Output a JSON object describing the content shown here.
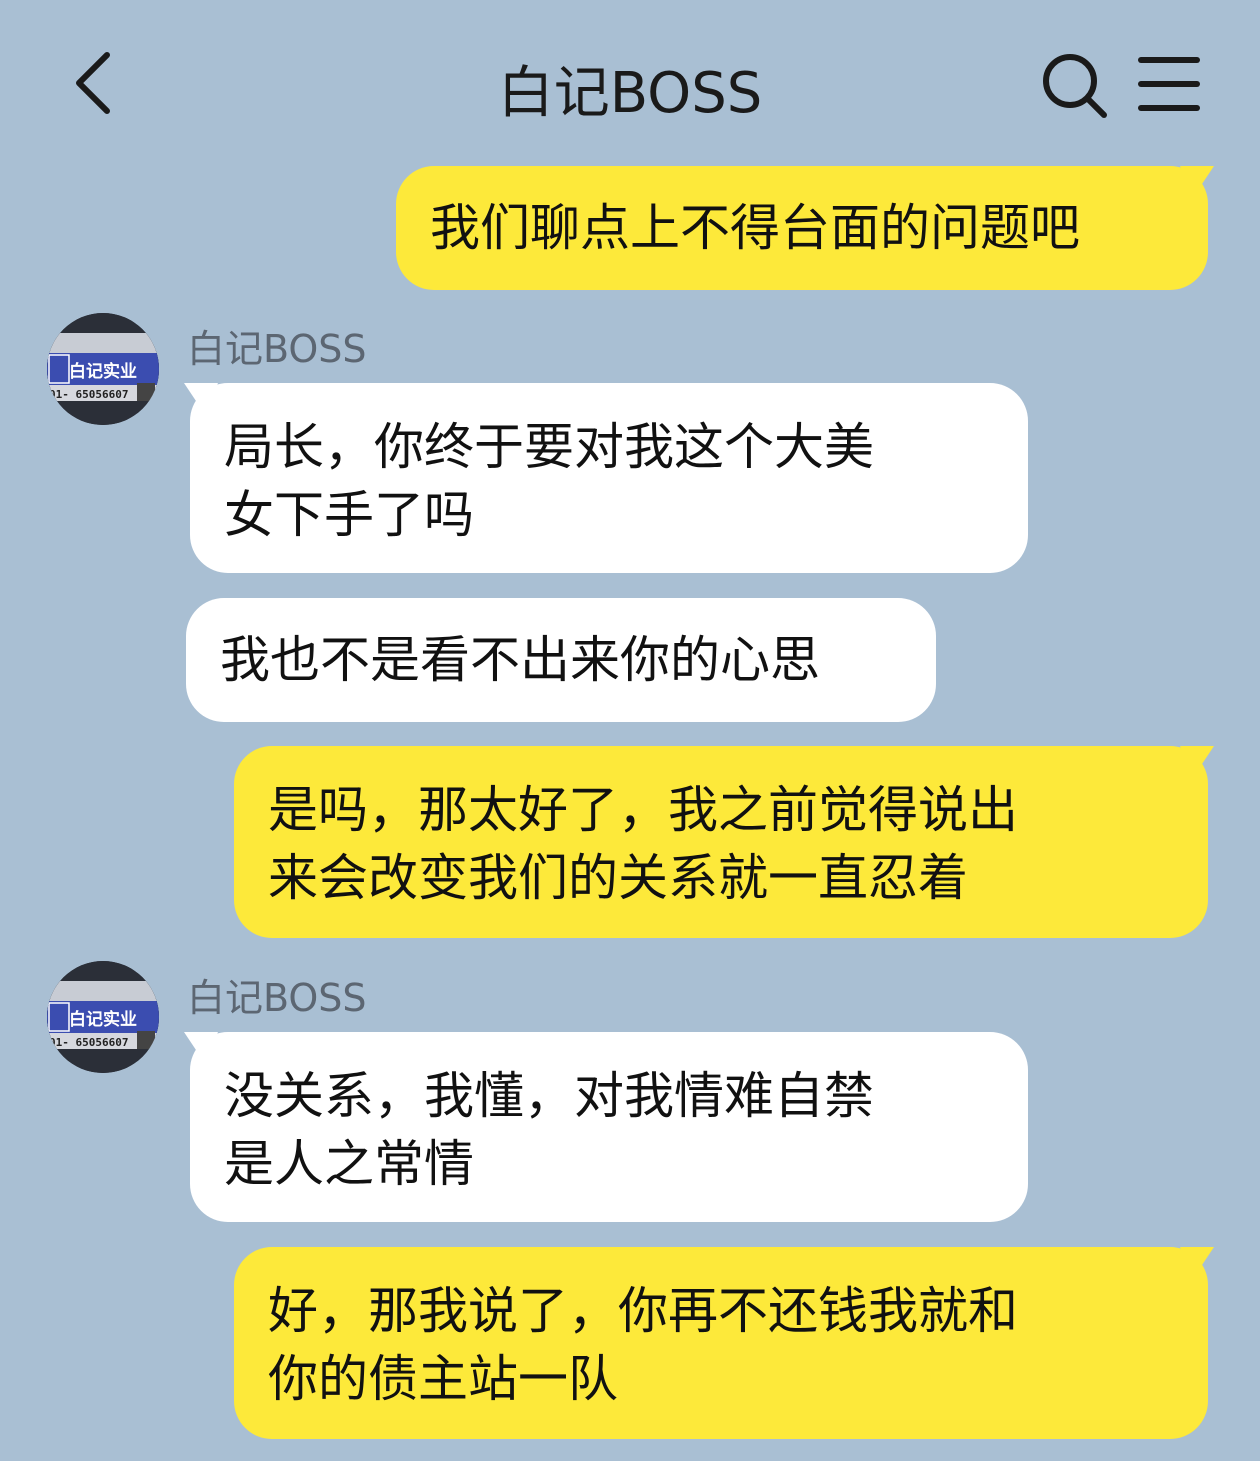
{
  "header": {
    "title": "白记BOSS"
  },
  "icons": {
    "back": "chevron-left-icon",
    "search": "search-icon",
    "menu": "hamburger-menu-icon"
  },
  "colors": {
    "background": "#a9bfd3",
    "mine_bubble": "#fde93a",
    "theirs_bubble": "#ffffff"
  },
  "messages": [
    {
      "from": "me",
      "lines": [
        "我们聊点上不得台面的问题吧"
      ]
    },
    {
      "from": "白记BOSS",
      "sender_name": "白记BOSS",
      "avatar_text": "白记实业",
      "lines": [
        "局长，你终于要对我这个大美",
        "女下手了吗"
      ]
    },
    {
      "from": "白记BOSS",
      "lines": [
        "我也不是看不出来你的心思"
      ]
    },
    {
      "from": "me",
      "lines": [
        "是吗，那太好了，我之前觉得说出",
        "来会改变我们的关系就一直忍着"
      ]
    },
    {
      "from": "白记BOSS",
      "sender_name": "白记BOSS",
      "avatar_text": "白记实业",
      "lines": [
        "没关系，我懂，对我情难自禁",
        "是人之常情"
      ]
    },
    {
      "from": "me",
      "lines": [
        "好，那我说了，你再不还钱我就和",
        "你的债主站一队"
      ]
    }
  ]
}
